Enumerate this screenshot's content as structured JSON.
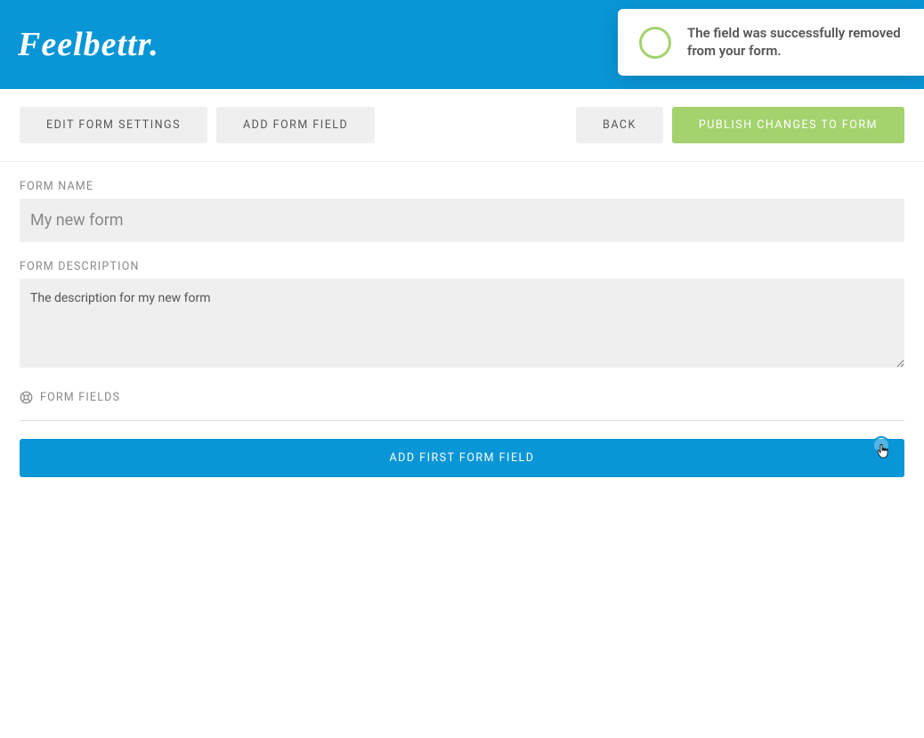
{
  "logo": "Feelbettr.",
  "toast": {
    "message": "The field was successfully removed from your form."
  },
  "toolbar": {
    "edit_settings_label": "EDIT FORM SETTINGS",
    "add_field_label": "ADD FORM FIELD",
    "back_label": "BACK",
    "publish_label": "PUBLISH CHANGES TO FORM"
  },
  "form": {
    "name_label": "FORM NAME",
    "name_value": "My new form",
    "description_label": "FORM DESCRIPTION",
    "description_value": "The description for my new form",
    "fields_label": "FORM FIELDS",
    "add_first_label": "ADD FIRST FORM FIELD"
  }
}
